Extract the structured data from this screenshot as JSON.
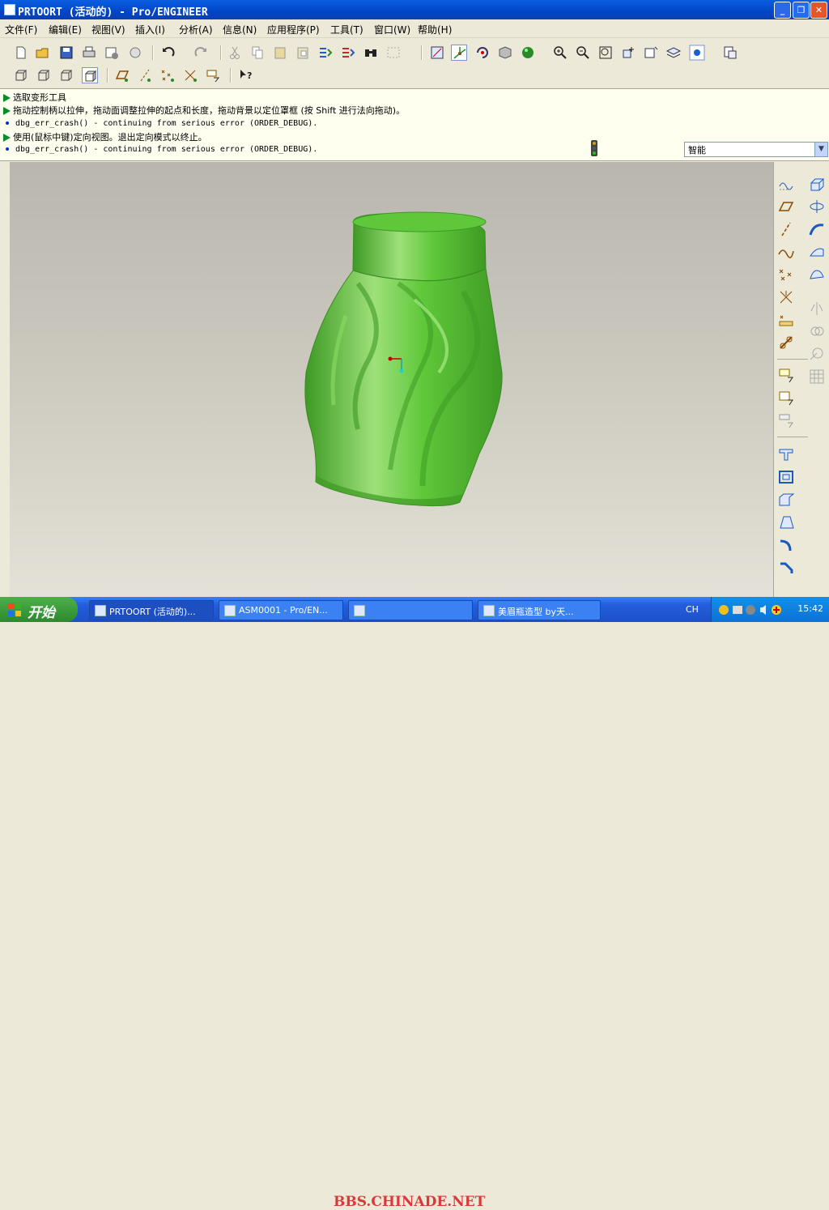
{
  "window": {
    "title": "PRTOORT (活动的) - Pro/ENGINEER",
    "minimize": "_",
    "maximize": "❐",
    "close": "✕"
  },
  "menu": [
    "文件(F)",
    "编辑(E)",
    "视图(V)",
    "插入(I)",
    "分析(A)",
    "信息(N)",
    "应用程序(P)",
    "工具(T)",
    "窗口(W)",
    "帮助(H)"
  ],
  "messages": [
    {
      "kind": "prompt",
      "text": "选取变形工具"
    },
    {
      "kind": "prompt",
      "text": "拖动控制柄以拉伸，拖动面调整拉伸的起点和长度，拖动背景以定位罩框 (按 Shift 进行法向拖动)。"
    },
    {
      "kind": "info",
      "text": "dbg_err_crash() - continuing from serious error (ORDER_DEBUG)."
    },
    {
      "kind": "prompt",
      "text": "使用(鼠标中键)定向视图。退出定向模式以终止。"
    },
    {
      "kind": "info",
      "text": "dbg_err_crash() - continuing from serious error (ORDER_DEBUG)."
    }
  ],
  "filter": {
    "value": "智能",
    "drop": "▼"
  },
  "model": {
    "color": "#5fc83a",
    "shade": "#3e9a24",
    "highlight": "#9ee07a"
  },
  "taskbar": {
    "start": "开始",
    "tasks": [
      "PRTOORT (活动的)...",
      "ASM0001 - Pro/EN...",
      "",
      "美眉瓶造型 by天..."
    ],
    "lang": "CH",
    "clock": "15:42",
    "watermark": "BBS.CHINADE.NET"
  },
  "icons": {
    "top_row": [
      "new-icon",
      "open-icon",
      "save-icon",
      "print-icon",
      "send-icon",
      "email-icon",
      "undo-icon",
      "redo-icon",
      "cut-icon",
      "copy-icon",
      "paste-icon",
      "paste-special-icon",
      "regenerate-icon",
      "regen-manager-icon",
      "find-icon",
      "select-box-icon",
      "repaint-icon",
      "spin-center-icon",
      "orient-icon",
      "saved-views-icon",
      "appearance-icon",
      "zoom-in-icon",
      "zoom-out-icon",
      "refit-icon",
      "reorient-icon",
      "view-manager-icon",
      "layers-icon",
      "display-style-icon",
      "model-tree-icon"
    ],
    "second_row": [
      "wireframe-icon",
      "hidden-line-icon",
      "no-hidden-icon",
      "shading-icon",
      "datum-plane-display-icon",
      "datum-axis-display-icon",
      "point-display-icon",
      "csys-display-icon",
      "annotation-display-icon",
      "context-help-icon"
    ],
    "right_col1": [
      "sketch-icon",
      "plane-icon",
      "axis-icon",
      "curve-icon",
      "point-icon",
      "csys-icon",
      "analysis-icon",
      "datum-tool-icon",
      "annotation-icon",
      "note-icon",
      "dim-icon",
      "hole-icon",
      "shell-icon",
      "rib-icon",
      "draft-icon",
      "round-icon",
      "chamfer-icon"
    ],
    "right_col2": [
      "extrude-icon",
      "revolve-icon",
      "sweep-icon",
      "blend-icon",
      "boundary-icon",
      "mirror-icon",
      "merge-icon",
      "trim-icon",
      "pattern-icon"
    ]
  }
}
